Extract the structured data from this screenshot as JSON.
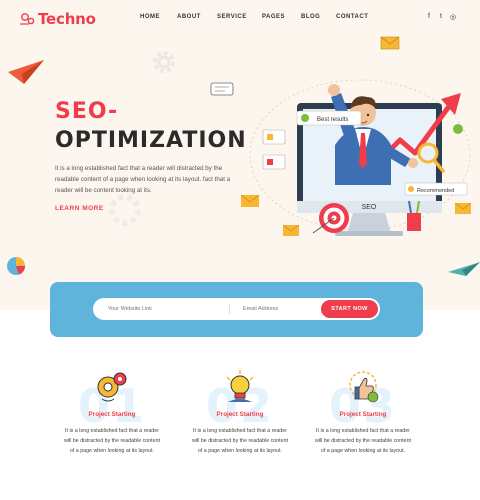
{
  "brand": {
    "name": "Techno"
  },
  "nav": {
    "items": [
      "HOME",
      "ABOUT",
      "SERVICE",
      "PAGES",
      "BLOG",
      "CONTACT"
    ]
  },
  "social": {
    "facebook": "f",
    "twitter": "t",
    "instagram": "◎"
  },
  "hero": {
    "title_line1": "SEO-",
    "title_line2": "OPTIMIZATION",
    "description": "It is a long established fact that a reader will distracted by the readable content of a page when looking at its layout. fact that a reader will be content looking at its.",
    "cta": "LEARN MORE",
    "illustration": {
      "badge_best_results": "Best results",
      "badge_recommended": "Recommended",
      "screen_text": "SEO"
    }
  },
  "subscribe": {
    "website_placeholder": "Your Website Link",
    "email_placeholder": "Email Address",
    "button": "START NOW"
  },
  "features": [
    {
      "number": "01",
      "icon": "gear-bulb-icon",
      "title": "Project Starting",
      "description": "It is a long established fact that a reader will be distracted by the readable content of a page when looking at its layout."
    },
    {
      "number": "02",
      "icon": "lightbulb-icon",
      "title": "Project Starting",
      "description": "It is a long established fact that a reader will be distracted by the readable content of a page when looking at its layout."
    },
    {
      "number": "03",
      "icon": "thumbs-up-icon",
      "title": "Project Starting",
      "description": "It is a long established fact that a reader will be distracted by the readable content of a page when looking at its layout."
    }
  ],
  "colors": {
    "accent": "#ef3d4b",
    "hero_bg": "#fdf6ef",
    "subscribe_bg": "#5fb4dc",
    "number_tint": "#e3f2fb"
  }
}
